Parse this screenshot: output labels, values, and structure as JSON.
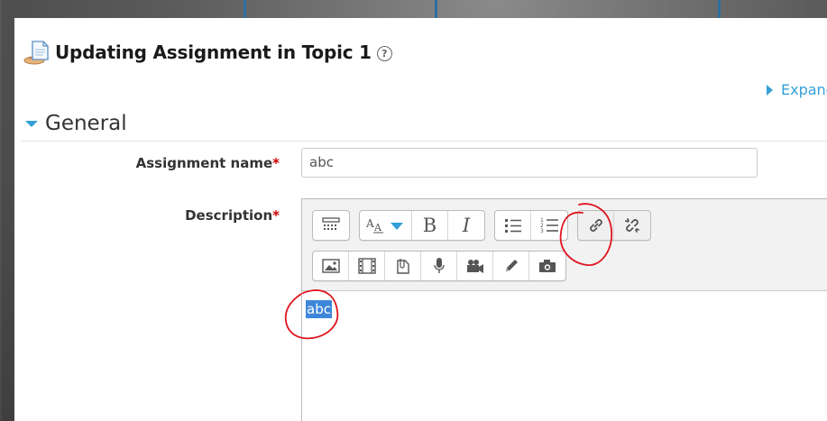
{
  "page": {
    "title": "Updating Assignment in Topic 1",
    "expand_all": "Expand all"
  },
  "form": {
    "section_legend": "General",
    "assignment_name": {
      "label": "Assignment name",
      "required_mark": "*",
      "value": "abc"
    },
    "description": {
      "label": "Description",
      "required_mark": "*",
      "content": "abc"
    }
  },
  "editor": {
    "toolbar_row1": [
      {
        "icon": "show-more-buttons-icon"
      },
      {
        "icon": "font-style-icon"
      },
      {
        "icon": "bold-icon",
        "glyph": "B"
      },
      {
        "icon": "italic-icon",
        "glyph": "I"
      },
      {
        "icon": "unordered-list-icon"
      },
      {
        "icon": "ordered-list-icon"
      },
      {
        "icon": "link-icon"
      },
      {
        "icon": "unlink-icon"
      }
    ],
    "toolbar_row2": [
      {
        "icon": "image-icon"
      },
      {
        "icon": "media-icon"
      },
      {
        "icon": "manage-files-icon"
      },
      {
        "icon": "record-audio-icon"
      },
      {
        "icon": "record-video-icon"
      },
      {
        "icon": "drawing-icon"
      },
      {
        "icon": "screenshot-camera-icon"
      }
    ]
  },
  "colors": {
    "accent": "#34a0d8",
    "selection": "#3d86d9",
    "required": "#cc0000",
    "annotation": "#e0141e"
  }
}
